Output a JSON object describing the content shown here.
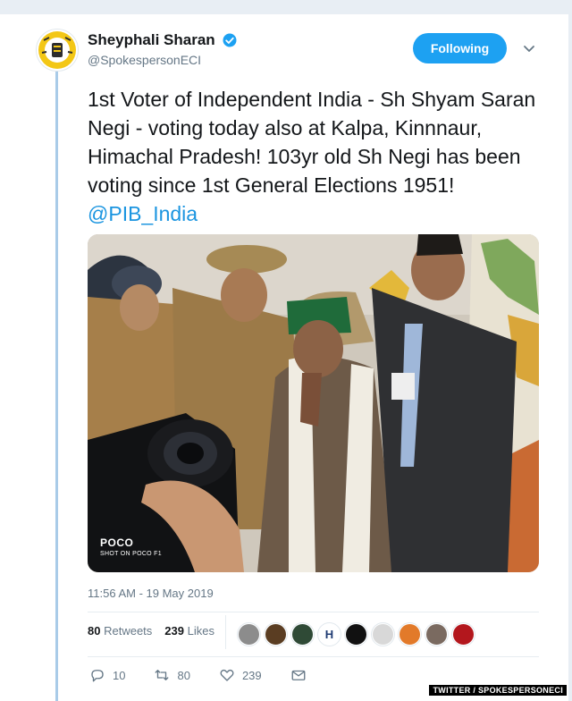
{
  "user": {
    "display_name": "Sheyphali Sharan",
    "handle": "@SpokespersonECI",
    "verified": true,
    "avatar_icon": "eci-logo-icon"
  },
  "follow_button": {
    "label": "Following"
  },
  "menu": {
    "icon": "chevron-down-icon"
  },
  "tweet": {
    "text": "1st Voter of Independent India - Sh Shyam Saran Negi - voting today also at Kalpa, Kinnnaur, Himachal Pradesh! 103yr old Sh Negi has been voting since 1st General Elections 1951!",
    "mention": "@PIB_India"
  },
  "photo": {
    "watermark_brand": "POCO",
    "watermark_caption": "SHOT ON POCO F1"
  },
  "timestamp": "11:56 AM - 19 May 2019",
  "stats": {
    "retweets_count": "80",
    "retweets_label": "Retweets",
    "likes_count": "239",
    "likes_label": "Likes"
  },
  "actions": {
    "reply_count": "10",
    "retweet_count": "80",
    "like_count": "239"
  },
  "credit": "TWITTER / SPOKESPERSONECI",
  "colors": {
    "accent": "#1da1f2",
    "link": "#1b95e0",
    "muted": "#657786",
    "text": "#14171a"
  }
}
